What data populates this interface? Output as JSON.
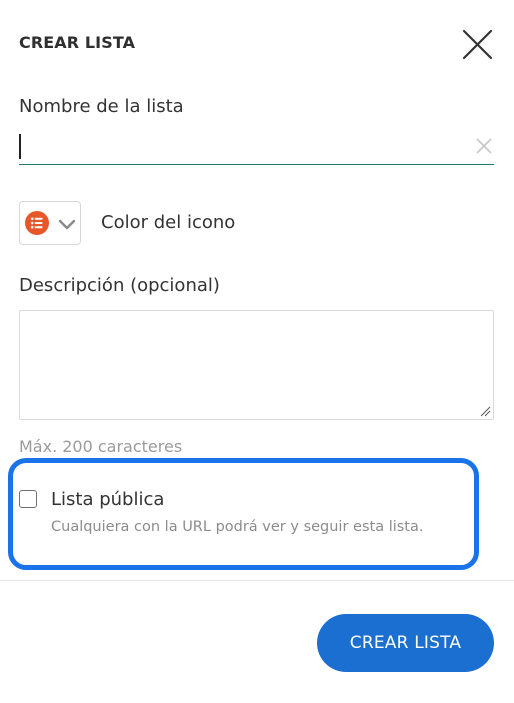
{
  "dialog": {
    "title": "CREAR LISTA",
    "close_icon": "close-icon"
  },
  "name_field": {
    "label": "Nombre de la lista",
    "value": "",
    "placeholder": "",
    "clear_icon": "clear-icon"
  },
  "icon_color": {
    "label": "Color del icono",
    "selected_color": "#e8572a",
    "icon": "list-icon",
    "dropdown_icon": "chevron-down-icon"
  },
  "description_field": {
    "label": "Descripción (opcional)",
    "value": "",
    "hint": "Máx. 200 caracteres"
  },
  "public_option": {
    "label": "Lista pública",
    "description": "Cualquiera con la URL podrá ver y seguir esta lista.",
    "checked": false,
    "highlight_color": "#1a73e8"
  },
  "actions": {
    "create_label": "CREAR LISTA",
    "button_color": "#1a6fd1"
  }
}
